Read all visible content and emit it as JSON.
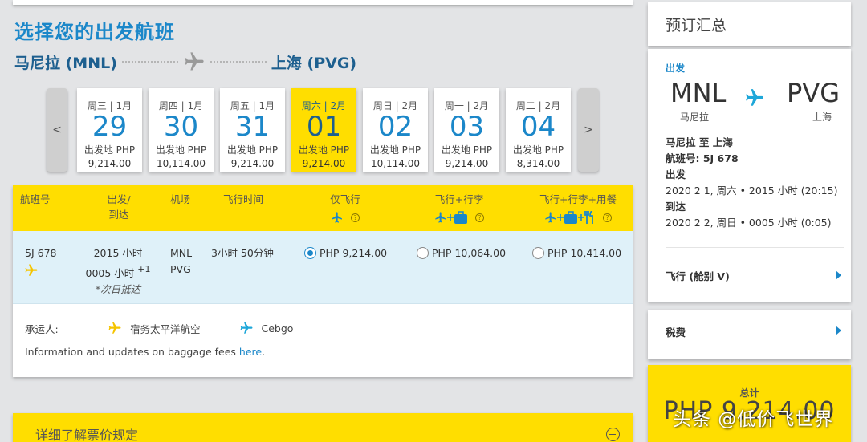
{
  "page": {
    "title": "选择您的出发航班",
    "origin": "马尼拉 (MNL)",
    "destination": "上海 (PVG)"
  },
  "date_selector": {
    "prev_label": "<",
    "next_label": ">",
    "dates": [
      {
        "weekday": "周三 | 1月",
        "day": "29",
        "from_label": "出发地 PHP",
        "price": "9,214.00",
        "selected": false
      },
      {
        "weekday": "周四 | 1月",
        "day": "30",
        "from_label": "出发地 PHP",
        "price": "10,114.00",
        "selected": false
      },
      {
        "weekday": "周五 | 1月",
        "day": "31",
        "from_label": "出发地 PHP",
        "price": "9,214.00",
        "selected": false
      },
      {
        "weekday": "周六 | 2月",
        "day": "01",
        "from_label": "出发地 PHP",
        "price": "9,214.00",
        "selected": true
      },
      {
        "weekday": "周日 | 2月",
        "day": "02",
        "from_label": "出发地 PHP",
        "price": "10,114.00",
        "selected": false
      },
      {
        "weekday": "周一 | 2月",
        "day": "03",
        "from_label": "出发地 PHP",
        "price": "9,214.00",
        "selected": false
      },
      {
        "weekday": "周二 | 2月",
        "day": "04",
        "from_label": "出发地 PHP",
        "price": "8,314.00",
        "selected": false
      }
    ]
  },
  "flight_table": {
    "headers": {
      "flight_no": "航班号",
      "depart_arrive_1": "出发/",
      "depart_arrive_2": "到达",
      "airport": "机场",
      "duration": "飞行时间",
      "fare_fly": "仅飞行",
      "fare_fly_bag": "飞行+行李",
      "fare_fly_bag_meal": "飞行+行李+用餐",
      "info_glyph": "?"
    },
    "rows": [
      {
        "flight_no": "5J 678",
        "depart": "2015 小时",
        "arrive": "0005 小时",
        "arrive_offset": "+1",
        "next_day": "*次日抵达",
        "airport_from": "MNL",
        "airport_to": "PVG",
        "duration": "3小时 50分钟",
        "fares": [
          "PHP 9,214.00",
          "PHP 10,064.00",
          "PHP 10,414.00"
        ],
        "selected_fare": 0
      }
    ],
    "carrier_label": "承运人:",
    "carriers": [
      "宿务太平洋航空",
      "Cebgo"
    ],
    "baggage_text": "Information and updates on baggage fees ",
    "baggage_link": "here",
    "baggage_end": "."
  },
  "fare_rules": {
    "label": "详细了解票价规定"
  },
  "summary": {
    "title": "预订汇总",
    "departure_label": "出发",
    "from_code": "MNL",
    "from_city": "马尼拉",
    "to_code": "PVG",
    "to_city": "上海",
    "route": "马尼拉 至 上海",
    "flight": "航班号: 5J 678",
    "depart_label": "出发",
    "depart_time": "2020 2 1, 周六 • 2015 小时 (20:15)",
    "arrive_label": "到达",
    "arrive_time": "2020 2 2, 周日 • 0005 小时 (0:05)",
    "fare_class": "飞行 (舱别 V)",
    "tax_label": "税费",
    "total_label": "总计",
    "total_amount": "PHP 9,214.00"
  },
  "watermark": "头条 @低价飞世界",
  "colors": {
    "brand_yellow": "#ffde00",
    "brand_blue": "#1b87c9",
    "row_highlight": "#dff1f9"
  }
}
